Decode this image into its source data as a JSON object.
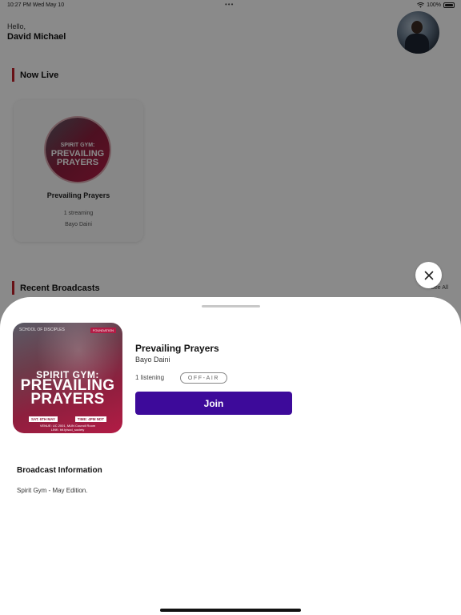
{
  "status_bar": {
    "time": "10:27 PM",
    "date": "Wed May 10",
    "dots": "•••",
    "battery": "100%"
  },
  "header": {
    "greeting": "Hello,",
    "username": "David Michael"
  },
  "now_live": {
    "title": "Now Live",
    "card": {
      "title": "Prevailing Prayers",
      "streaming": "1 streaming",
      "host": "Bayo Daini"
    }
  },
  "recent": {
    "title": "Recent Broadcasts",
    "see_all": "See All"
  },
  "sheet": {
    "title": "Prevailing Prayers",
    "host": "Bayo Daini",
    "listening": "1 listening",
    "status": "OFF-AIR",
    "join_label": "Join",
    "info_heading": "Broadcast Information",
    "info_text": "Spirit Gym - May Edition.",
    "cover": {
      "brand": "SCHOOL OF DISCIPLES",
      "tag": "FOUNDATION",
      "line1": "SPIRIT GYM:",
      "line2a": "PREVAILING",
      "line2b": "PRAYERS",
      "date": "SAT. 6TH MAY",
      "time": "TIME: 4PM NDT",
      "venue_a": "VENUE: UC 2001, MUN Council Room",
      "venue_b": "LINK: bit.ly/sod_society"
    }
  },
  "colors": {
    "accent": "#3d0a9a",
    "section_bar": "#c0202a",
    "overlay": "rgba(0,0,0,0.46)"
  }
}
